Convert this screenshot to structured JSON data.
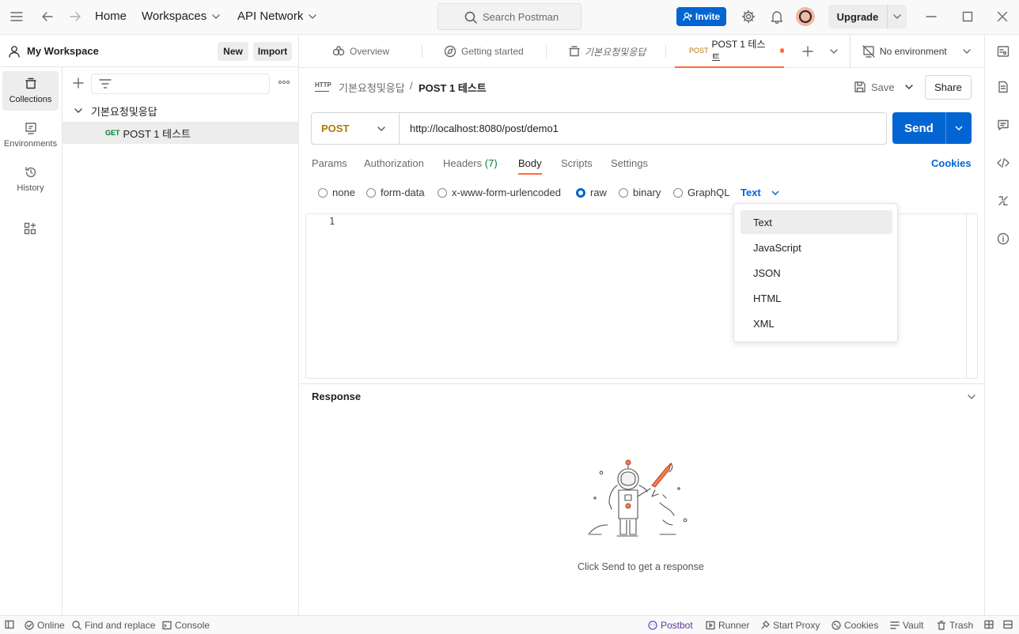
{
  "topbar": {
    "home": "Home",
    "workspaces": "Workspaces",
    "api_network": "API Network",
    "search_placeholder": "Search Postman",
    "invite": "Invite",
    "upgrade": "Upgrade"
  },
  "sidebar": {
    "items": [
      {
        "label": "Collections",
        "icon": "collections-icon"
      },
      {
        "label": "Environments",
        "icon": "environments-icon"
      },
      {
        "label": "History",
        "icon": "history-icon"
      }
    ]
  },
  "workspace": {
    "name": "My Workspace",
    "new_label": "New",
    "import_label": "Import"
  },
  "collections": {
    "folder": "기본요청및응답",
    "request_method": "GET",
    "request_name": "POST 1 테스트"
  },
  "tabs": [
    {
      "label": "Overview"
    },
    {
      "label": "Getting started"
    },
    {
      "label": "기본요청및응답"
    },
    {
      "method": "POST",
      "label": "POST 1 테스트"
    }
  ],
  "environment": "No environment",
  "request": {
    "breadcrumb_parent": "기본요청및응답",
    "breadcrumb_sep": "/",
    "title": "POST 1 테스트",
    "save": "Save",
    "share": "Share",
    "method": "POST",
    "url": "http://localhost:8080/post/demo1",
    "send": "Send",
    "subtabs": [
      "Params",
      "Authorization",
      "Headers",
      "(7)",
      "Body",
      "Scripts",
      "Settings"
    ],
    "cookies": "Cookies",
    "body_types": [
      "none",
      "form-data",
      "x-www-form-urlencoded",
      "raw",
      "binary",
      "GraphQL"
    ],
    "selected_body_type": "raw",
    "raw_format": "Text",
    "line_number": "1"
  },
  "format_dropdown": {
    "options": [
      "Text",
      "JavaScript",
      "JSON",
      "HTML",
      "XML"
    ],
    "highlighted": "Text"
  },
  "response": {
    "title": "Response",
    "empty_message": "Click Send to get a response"
  },
  "statusbar": {
    "online": "Online",
    "find_replace": "Find and replace",
    "console": "Console",
    "postbot": "Postbot",
    "runner": "Runner",
    "start_proxy": "Start Proxy",
    "cookies": "Cookies",
    "vault": "Vault",
    "trash": "Trash"
  },
  "colors": {
    "accent_blue": "#0265d2",
    "tab_active_orange": "#ff6c37",
    "post_method": "#ad7a03",
    "get_method": "#007f31"
  }
}
